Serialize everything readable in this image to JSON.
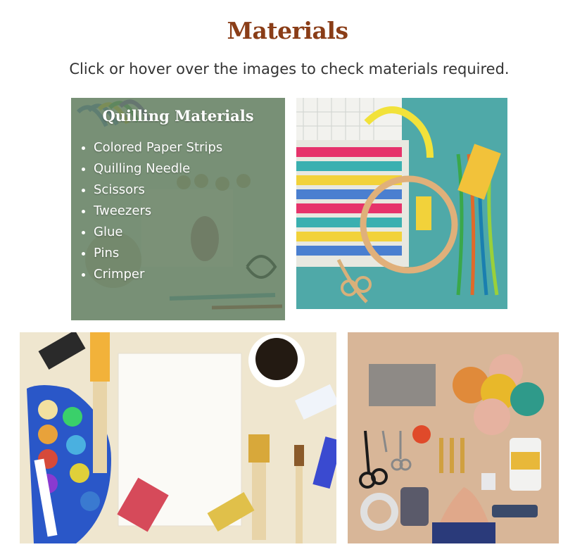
{
  "header": {
    "title": "Materials",
    "subtitle": "Click or hover over the images to check materials required."
  },
  "quilling": {
    "heading": "Quilling Materials",
    "items": [
      "Colored Paper Strips",
      "Quilling Needle",
      "Scissors",
      "Tweezers",
      "Glue",
      "Pins",
      "Crimper"
    ]
  },
  "colors": {
    "title": "#8a3d17",
    "overlay": "#5c7a5c"
  }
}
